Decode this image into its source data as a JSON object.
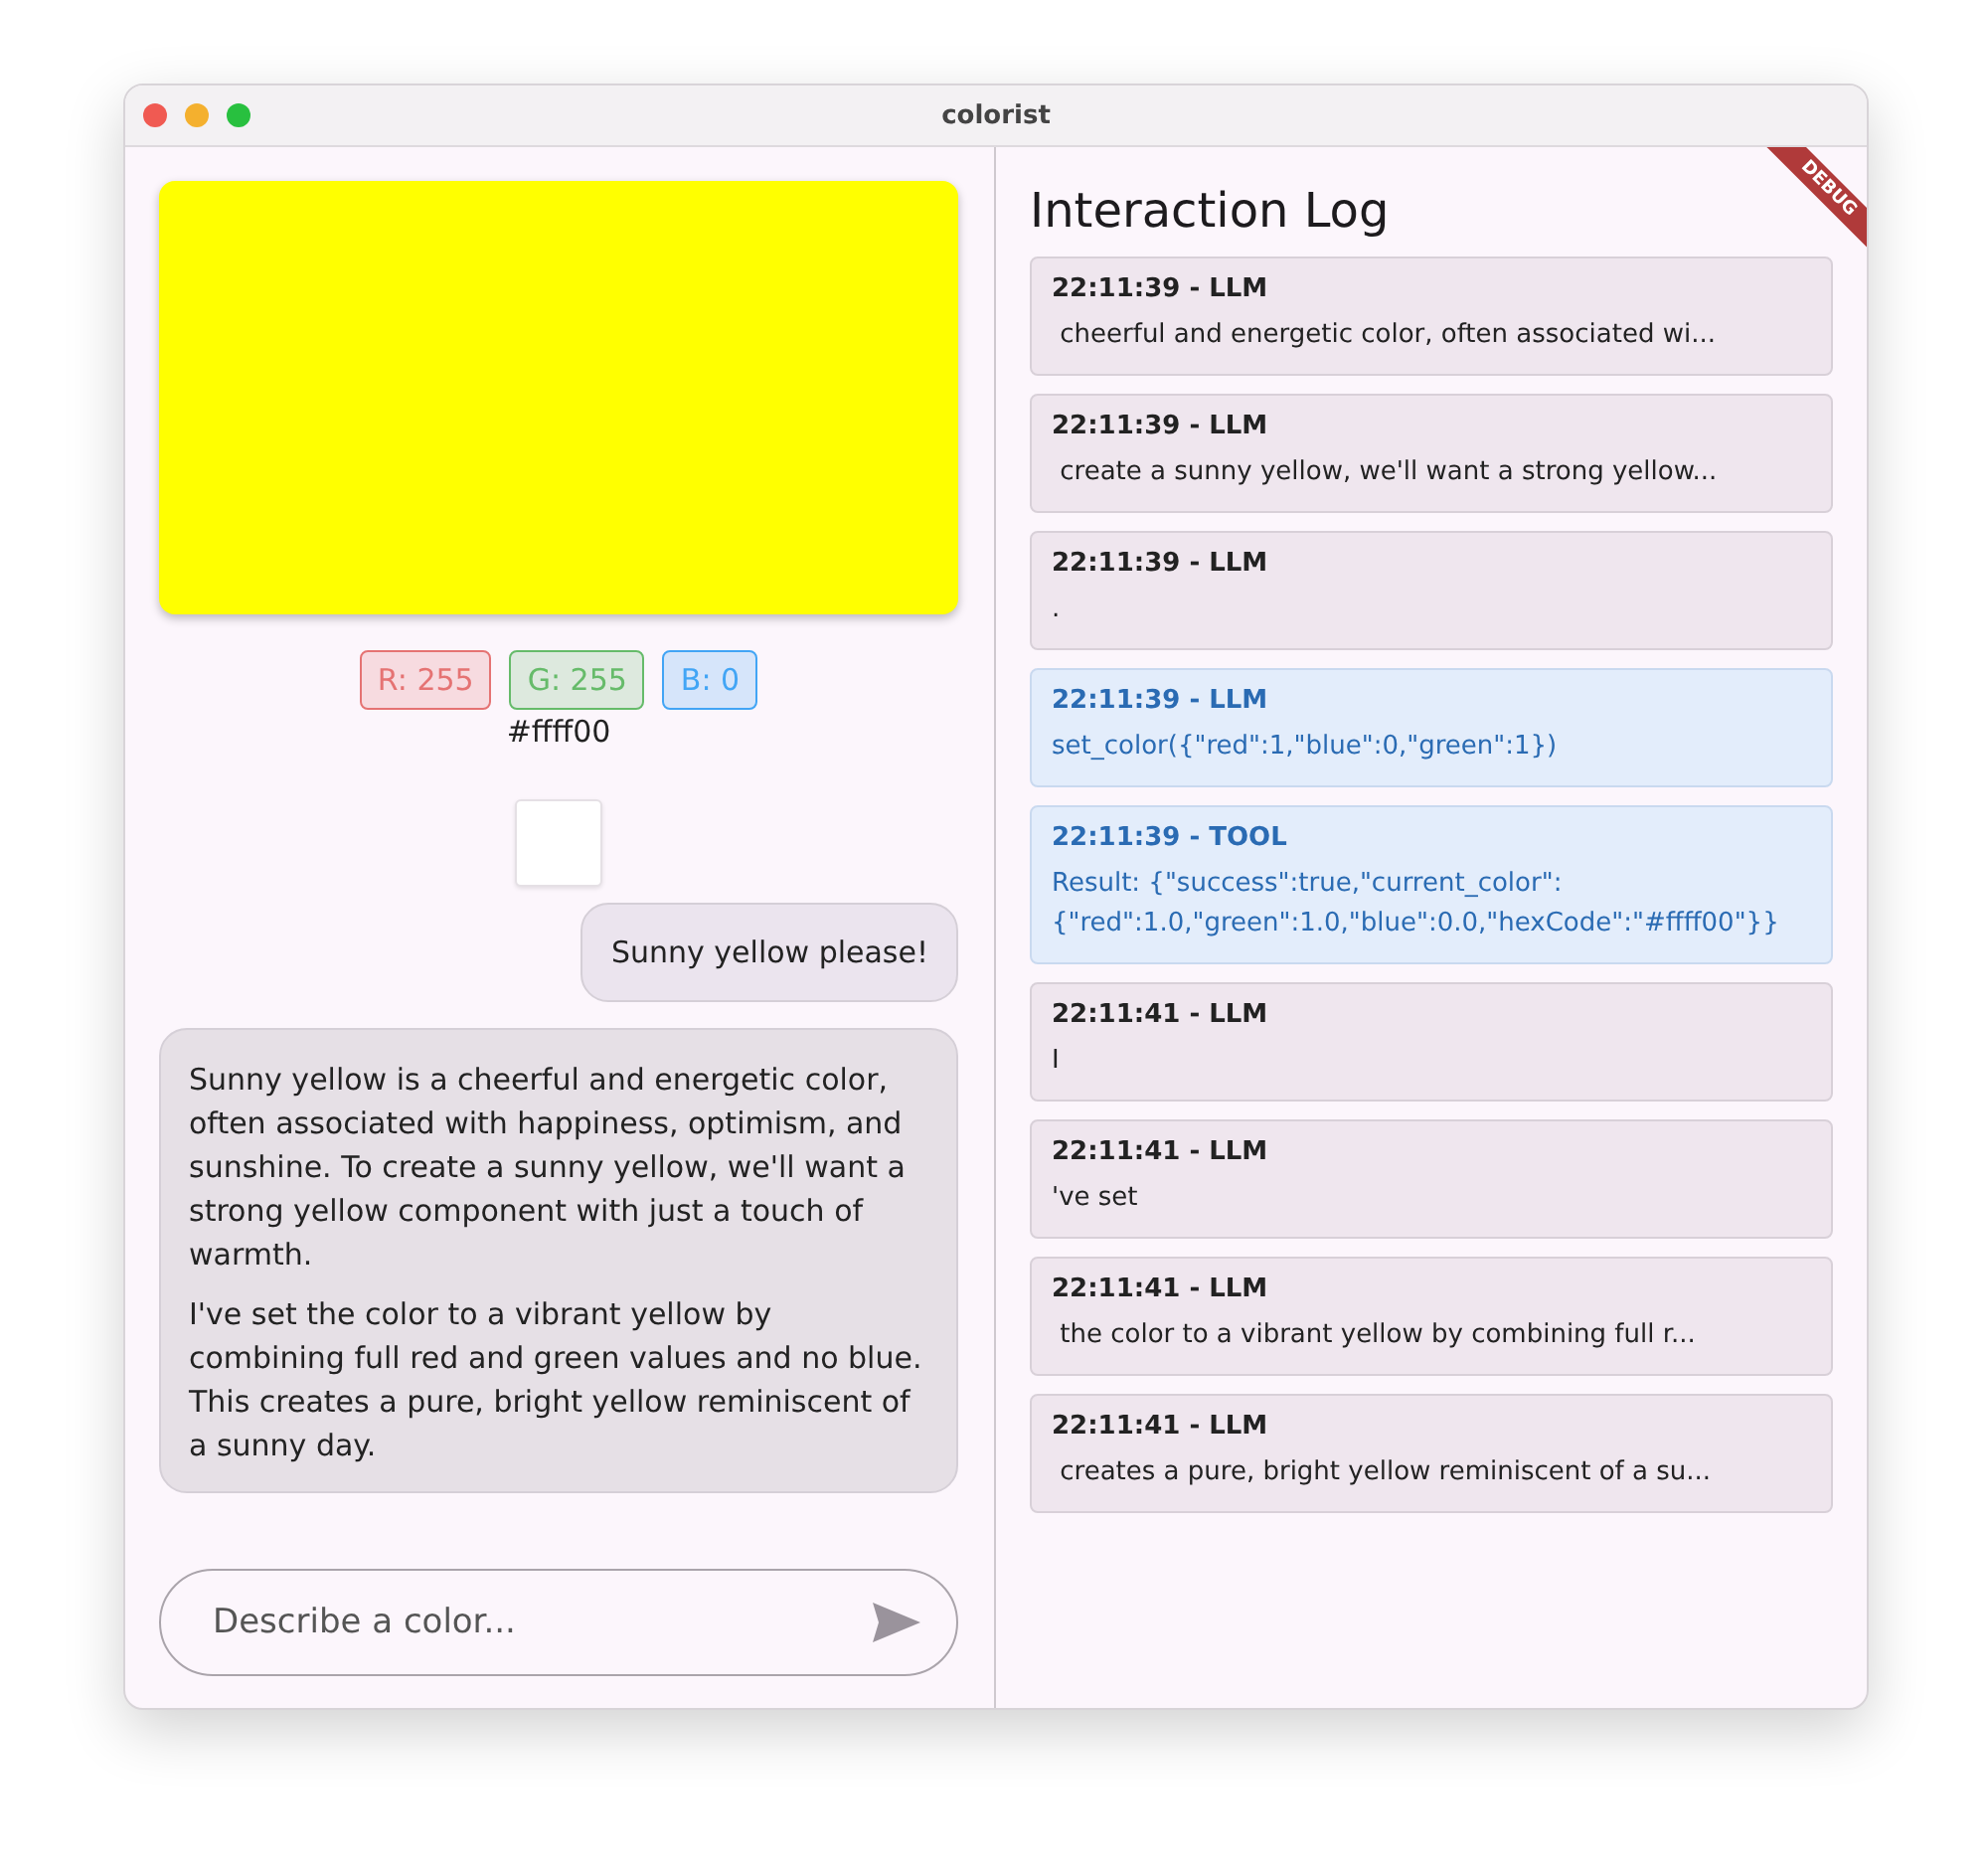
{
  "window": {
    "title": "colorist"
  },
  "debug_banner": "DEBUG",
  "color_panel": {
    "color": "#ffff00",
    "hex": "#ffff00",
    "channels": [
      {
        "label": "R: 255",
        "color": "#e57373"
      },
      {
        "label": "G: 255",
        "color": "#66bb6a"
      },
      {
        "label": "B: 0",
        "color": "#42a5f5"
      }
    ]
  },
  "chat": [
    {
      "kind": "user",
      "paragraphs": [
        "Sunny yellow please!"
      ]
    },
    {
      "kind": "assistant",
      "paragraphs": [
        "Sunny yellow is a cheerful and energetic color, often associated with happiness, optimism, and sunshine. To create a sunny yellow, we'll want a strong yellow component with just a touch of warmth.",
        "I've set the color to a vibrant yellow by combining full red and green values and no blue. This creates a pure, bright yellow reminiscent of a sunny day."
      ]
    }
  ],
  "input": {
    "placeholder": "Describe a color..."
  },
  "log": {
    "title": "Interaction Log",
    "entries": [
      {
        "kind": "text",
        "header": "22:11:39 - LLM",
        "text": " cheerful and energetic color, often associated wi..."
      },
      {
        "kind": "text",
        "header": "22:11:39 - LLM",
        "text": " create a sunny yellow, we'll want a strong yellow..."
      },
      {
        "kind": "text",
        "header": "22:11:39 - LLM",
        "text": "."
      },
      {
        "kind": "tool",
        "header": "22:11:39 - LLM",
        "text": "set_color({\"red\":1,\"blue\":0,\"green\":1})"
      },
      {
        "kind": "tool",
        "header": "22:11:39 - TOOL",
        "text": "Result: {\"success\":true,\"current_color\":{\"red\":1.0,\"green\":1.0,\"blue\":0.0,\"hexCode\":\"#ffff00\"}}"
      },
      {
        "kind": "text",
        "header": "22:11:41 - LLM",
        "text": "I"
      },
      {
        "kind": "text",
        "header": "22:11:41 - LLM",
        "text": "'ve set"
      },
      {
        "kind": "text",
        "header": "22:11:41 - LLM",
        "text": " the color to a vibrant yellow by combining full r..."
      },
      {
        "kind": "text",
        "header": "22:11:41 - LLM",
        "text": " creates a pure, bright yellow reminiscent of a su..."
      }
    ]
  }
}
